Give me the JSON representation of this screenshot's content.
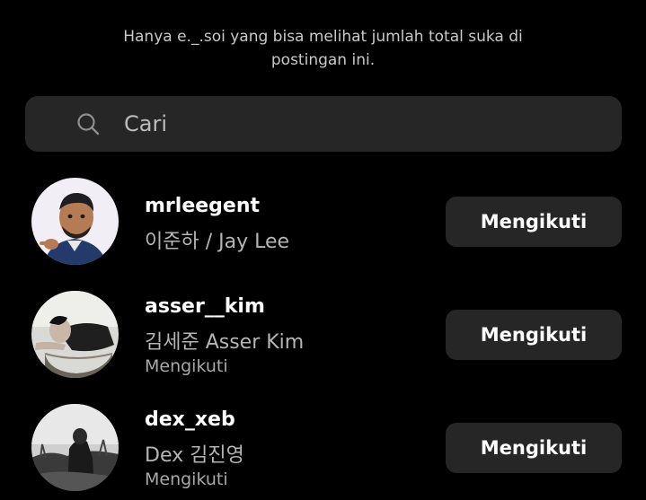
{
  "notice": "Hanya e._.soi yang bisa melihat jumlah total suka di postingan ini.",
  "search": {
    "placeholder": "Cari",
    "value": ""
  },
  "users": [
    {
      "username": "mrleegent",
      "full_name": "이준하 / Jay Lee",
      "status": "",
      "button_label": "Mengikuti"
    },
    {
      "username": "asser__kim",
      "full_name": "김세준 Asser Kim",
      "status": "Mengikuti",
      "button_label": "Mengikuti"
    },
    {
      "username": "dex_xeb",
      "full_name": "Dex 김진영",
      "status": "Mengikuti",
      "button_label": "Mengikuti"
    }
  ],
  "icons": {
    "search": "search-icon"
  },
  "colors": {
    "background": "#000000",
    "surface": "#262626",
    "primary_text": "#ffffff",
    "secondary_text": "#b5b5b5"
  }
}
